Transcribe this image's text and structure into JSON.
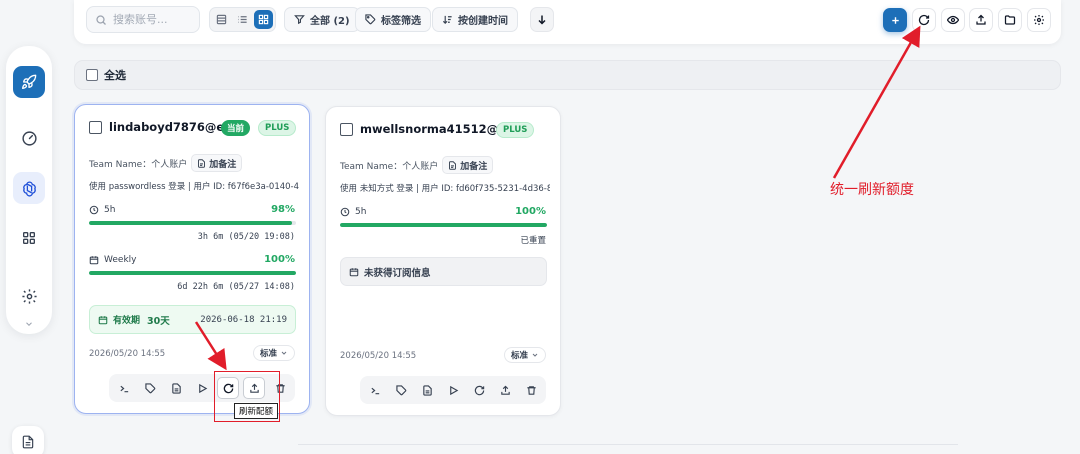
{
  "toolbar": {
    "search_placeholder": "搜索账号...",
    "filter_all_label": "全部 (2)",
    "tag_filter_label": "标签筛选",
    "sort_label": "按创建时间"
  },
  "select_all_label": "全选",
  "cards": [
    {
      "email": "lindaboyd7876@ed...",
      "current_badge": "当前",
      "plan_badge": "PLUS",
      "team_label": "Team Name：个人账户",
      "add_note_label": "加备注",
      "login_info": "使用 passwordless 登录 | 用户 ID: f67f6e3a-0140-4da...",
      "quota_5h_label": "5h",
      "quota_5h_percent": "98%",
      "quota_5h_fraction": 0.98,
      "quota_5h_reset": "3h 6m (05/20 19:08)",
      "quota_weekly_label": "Weekly",
      "quota_weekly_percent": "100%",
      "quota_weekly_fraction": 1.0,
      "quota_weekly_reset": "6d 22h 6m (05/27 14:08)",
      "validity_label": "有效期",
      "validity_days": "30天",
      "validity_date": "2026-06-18 21:19",
      "created_date": "2026/05/20 14:55",
      "tier_label": "标准"
    },
    {
      "email": "mwellsnorma41512@ed...",
      "plan_badge": "PLUS",
      "team_label": "Team Name：个人账户",
      "add_note_label": "加备注",
      "login_info": "使用 未知方式 登录 | 用户 ID: fd60f735-5231-4d36-85...",
      "quota_5h_label": "5h",
      "quota_5h_percent": "100%",
      "quota_5h_fraction": 1.0,
      "quota_5h_reset": "已重置",
      "no_subscription_label": "未获得订阅信息",
      "created_date": "2026/05/20 14:55",
      "tier_label": "标准"
    }
  ],
  "tooltip_refresh_quota": "刷新配额",
  "annotation_text": "统一刷新额度",
  "colors": {
    "primary": "#1d6fb8",
    "success": "#22a863",
    "annotation": "#e11d2a"
  }
}
